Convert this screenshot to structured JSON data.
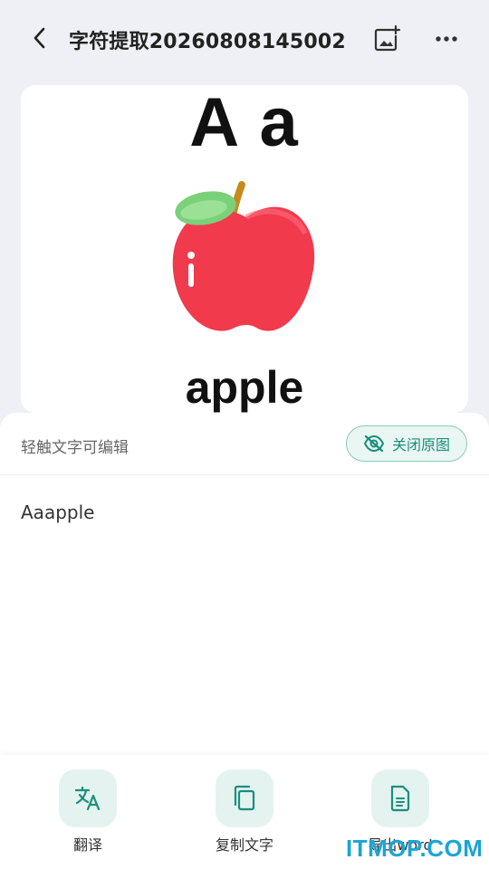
{
  "header": {
    "title": "字符提取20260808145002",
    "back_icon": "chevron-left-icon",
    "add_image_icon": "add-image-icon",
    "more_icon": "more-horizontal-icon"
  },
  "image_card": {
    "letters": "A a",
    "word": "apple",
    "illustration": "apple-illustration"
  },
  "sheet": {
    "hint": "轻触文字可编辑",
    "toggle_label": "关闭原图",
    "toggle_icon": "eye-off-icon",
    "recognized_text": "Aaapple"
  },
  "actions": [
    {
      "label": "翻译",
      "icon": "translate-icon"
    },
    {
      "label": "复制文字",
      "icon": "copy-icon"
    },
    {
      "label": "导出word",
      "icon": "document-icon"
    }
  ],
  "watermark": "ITMOP.COM",
  "colors": {
    "accent": "#1b8e7b",
    "accent_bg": "#e4f3f0",
    "page_bg": "#eef0f5"
  }
}
